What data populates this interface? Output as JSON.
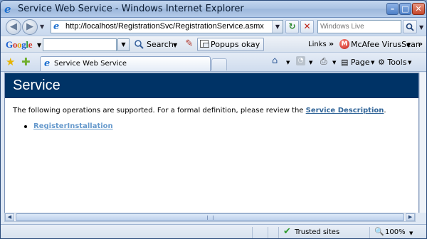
{
  "window": {
    "title": "Service Web Service - Windows Internet Explorer",
    "min_glyph": "–",
    "max_glyph": "□",
    "close_glyph": "✕"
  },
  "address_bar": {
    "url": "http://localhost/RegistrationSvc/RegistrationService.asmx",
    "search_placeholder": "Windows Live"
  },
  "google_toolbar": {
    "logo": [
      "G",
      "o",
      "o",
      "g",
      "l",
      "e"
    ],
    "search_label": "Search",
    "popups_label": "Popups okay",
    "links_label": "Links",
    "mcafee_label": "McAfee VirusScan"
  },
  "tab": {
    "label": "Service Web Service"
  },
  "commands": {
    "page_label": "Page",
    "tools_label": "Tools"
  },
  "page": {
    "heading": "Service",
    "intro_text": "The following operations are supported. For a formal definition, please review the ",
    "intro_link": "Service Description",
    "intro_end": ".",
    "operations": [
      "RegisterInstallation"
    ]
  },
  "status_bar": {
    "zone": "Trusted sites",
    "zoom": "100%"
  },
  "colors": {
    "header_bg": "#003366",
    "link": "#336699",
    "operation_link": "#6699cc"
  }
}
